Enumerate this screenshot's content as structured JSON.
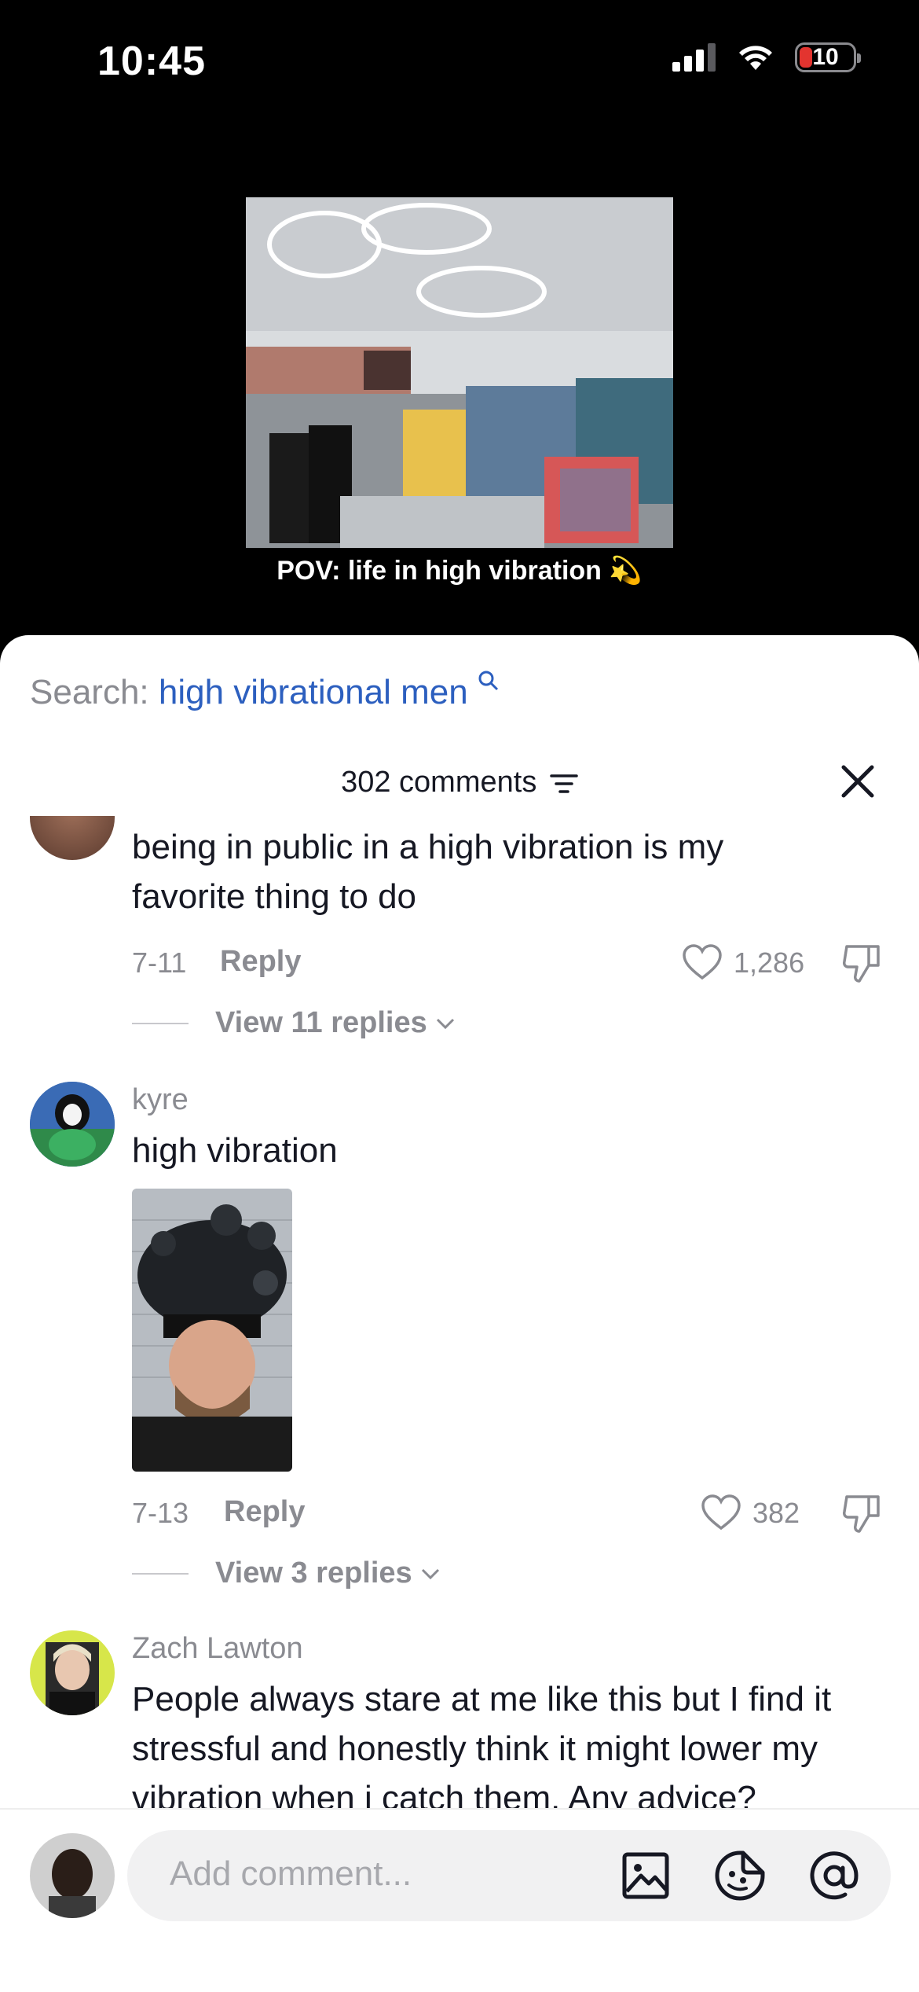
{
  "status_bar": {
    "time": "10:45",
    "battery": "10"
  },
  "video": {
    "caption": "POV: life in high vibration 💫"
  },
  "search": {
    "prefix": "Search: ",
    "query": "high vibrational men"
  },
  "comments_header": {
    "count_label": "302 comments"
  },
  "comments": [
    {
      "username": "",
      "text_line1": "being in public in a high vibration is my",
      "text_line2": "favorite thing to do",
      "date": "7-11",
      "reply": "Reply",
      "likes": "1,286",
      "view_replies": "View 11 replies"
    },
    {
      "username": "kyre",
      "text_line1": "high vibration",
      "date": "7-13",
      "reply": "Reply",
      "likes": "382",
      "view_replies": "View 3 replies"
    },
    {
      "username": "Zach Lawton",
      "text_line1": "People always stare at me like this but I find it",
      "text_line2": "stressful and honestly think it might lower my",
      "text_line3": "vibration when i catch them. Any advice?"
    }
  ],
  "composer": {
    "placeholder": "Add comment..."
  },
  "icons": [
    "signal-icon",
    "wifi-icon",
    "battery-icon",
    "search-icon",
    "filter-icon",
    "close-icon",
    "heart-icon",
    "dislike-icon",
    "chevron-down-icon",
    "image-icon",
    "sticker-icon",
    "mention-icon"
  ]
}
